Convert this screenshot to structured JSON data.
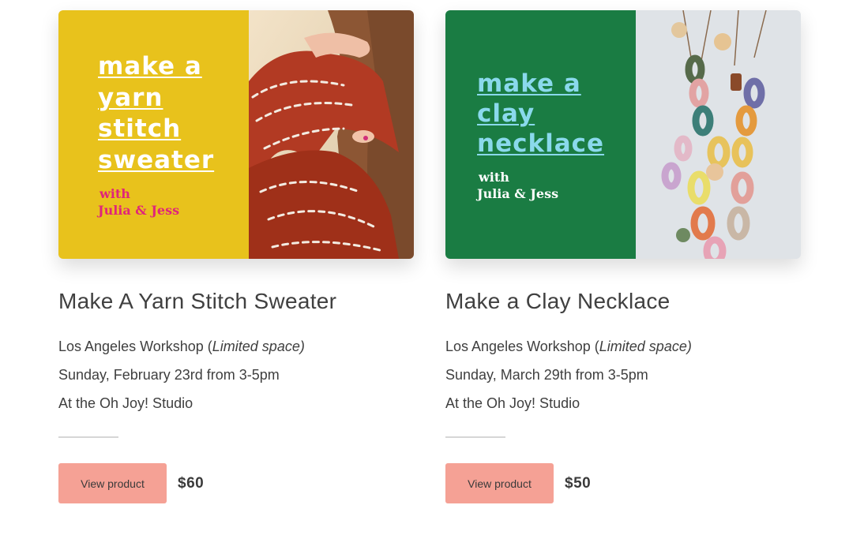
{
  "products": [
    {
      "promo": {
        "title_lines": [
          "make a",
          "yarn",
          "stitch",
          "sweater"
        ],
        "with": "with",
        "hosts": "Julia & Jess"
      },
      "title": "Make A Yarn Stitch Sweater",
      "location": "Los Angeles Workshop (",
      "location_note": "Limited space)",
      "date": "Sunday, February 23rd from 3-5pm",
      "venue": "At the Oh Joy! Studio",
      "button_label": "View product",
      "price": "$60",
      "colors": {
        "panel": "#e8c21c",
        "promo_title": "#ffffff",
        "promo_hosts": "#e0257a"
      }
    },
    {
      "promo": {
        "title_lines": [
          "make a",
          "clay",
          "necklace"
        ],
        "with": "with",
        "hosts": "Julia & Jess"
      },
      "title": "Make a Clay Necklace",
      "location": "Los Angeles Workshop (",
      "location_note": "Limited space)",
      "date": "Sunday, March 29th from 3-5pm",
      "venue": "At the Oh Joy! Studio",
      "button_label": "View product",
      "price": "$50",
      "colors": {
        "panel": "#1a7c43",
        "promo_title": "#8ad9ec",
        "promo_hosts": "#ffffff"
      }
    }
  ],
  "button_color": "#f5a195"
}
